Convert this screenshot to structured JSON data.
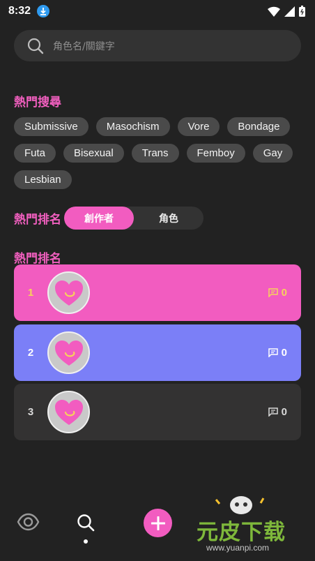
{
  "status_bar": {
    "time": "8:32"
  },
  "search": {
    "placeholder": "角色名/關鍵字"
  },
  "hot_search": {
    "title": "熱門搜尋",
    "tags": [
      "Submissive",
      "Masochism",
      "Vore",
      "Bondage",
      "Futa",
      "Bisexual",
      "Trans",
      "Femboy",
      "Gay",
      "Lesbian"
    ]
  },
  "ranking_toggle": {
    "title": "熱門排名",
    "options": [
      "創作者",
      "角色"
    ],
    "selected": "創作者"
  },
  "ranking_list": {
    "title": "熱門排名",
    "items": [
      {
        "rank": "1",
        "comments": "0",
        "color": "#f25cc0",
        "accent": "#f6d35a"
      },
      {
        "rank": "2",
        "comments": "0",
        "color": "#7b7ff7",
        "accent": "#ffffff"
      },
      {
        "rank": "3",
        "comments": "0",
        "color": "#333232",
        "accent": "#d9d9d9"
      }
    ]
  },
  "bottom_nav": {
    "items": [
      "eye-icon",
      "search-icon",
      "add-icon"
    ],
    "active": "search-icon"
  },
  "watermark": {
    "text": "元皮下载",
    "url": "www.yuanpi.com"
  },
  "colors": {
    "background": "#222222",
    "accent_pink": "#f15fbf",
    "chip_bg": "#4a4a4a"
  }
}
